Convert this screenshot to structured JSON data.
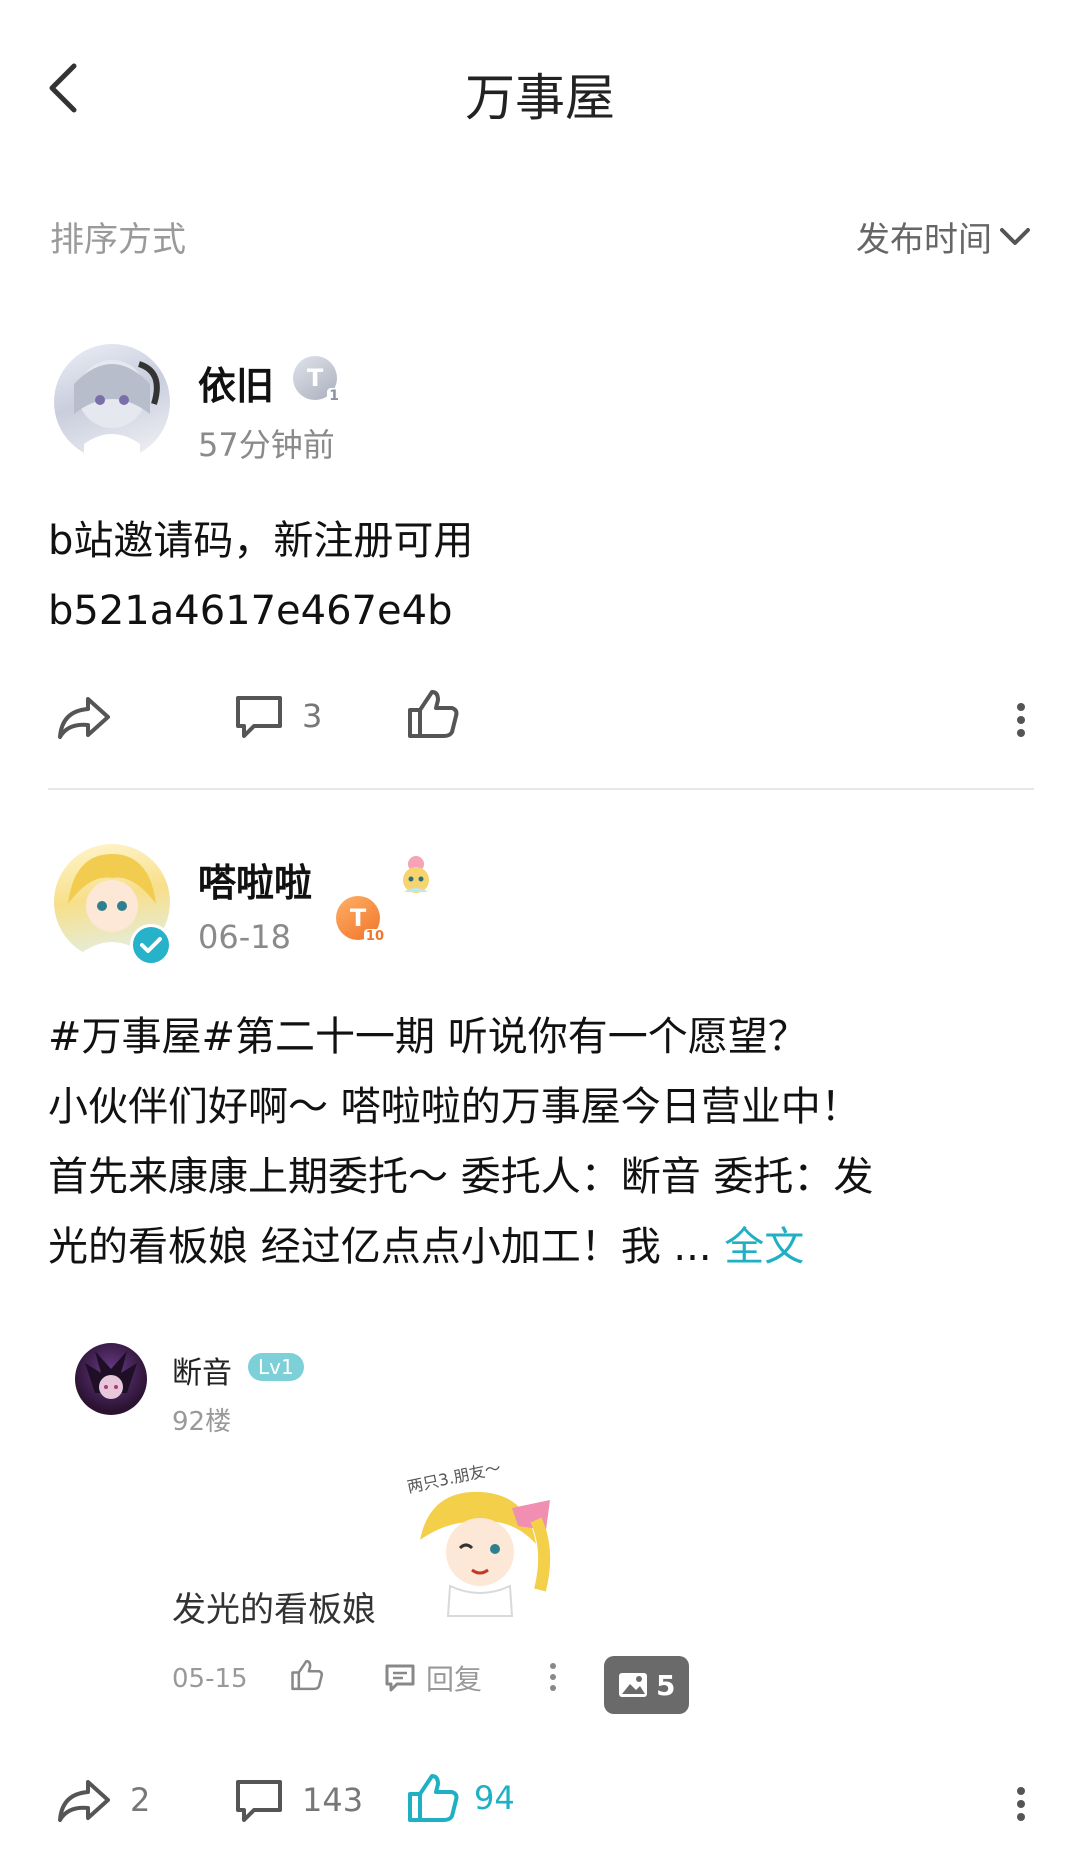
{
  "header": {
    "title": "万事屋"
  },
  "sort": {
    "label": "排序方式",
    "value": "发布时间"
  },
  "posts": [
    {
      "user": "依旧",
      "badge": "T",
      "badge_level": "1",
      "time": "57分钟前",
      "content_lines": [
        "b站邀请码，新注册可用",
        "b521a4617e467e4b"
      ],
      "comments": "3",
      "likes": ""
    },
    {
      "user": "嗒啦啦",
      "badge": "T",
      "badge_level": "10",
      "time": "06-18",
      "content_lines": [
        "#万事屋#第二十一期 听说你有一个愿望？",
        "小伙伴们好啊～ 嗒啦啦的万事屋今日营业中！",
        "首先来康康上期委托～ 委托人：断音 委托：发",
        "光的看板娘 经过亿点点小加工！我 ..."
      ],
      "full_text": "全文",
      "quote": {
        "user": "断音",
        "level": "Lv1",
        "floor": "92楼",
        "text": "发光的看板娘",
        "sticker_text": "两只3.朋友～",
        "date": "05-15",
        "reply": "回复",
        "image_count": "5"
      },
      "shares": "2",
      "comments": "143",
      "likes": "94"
    }
  ],
  "colors": {
    "accent": "#1fb0c4",
    "text": "#222222",
    "muted": "#8a8a8a",
    "badge_orange": "#f58a3b"
  }
}
